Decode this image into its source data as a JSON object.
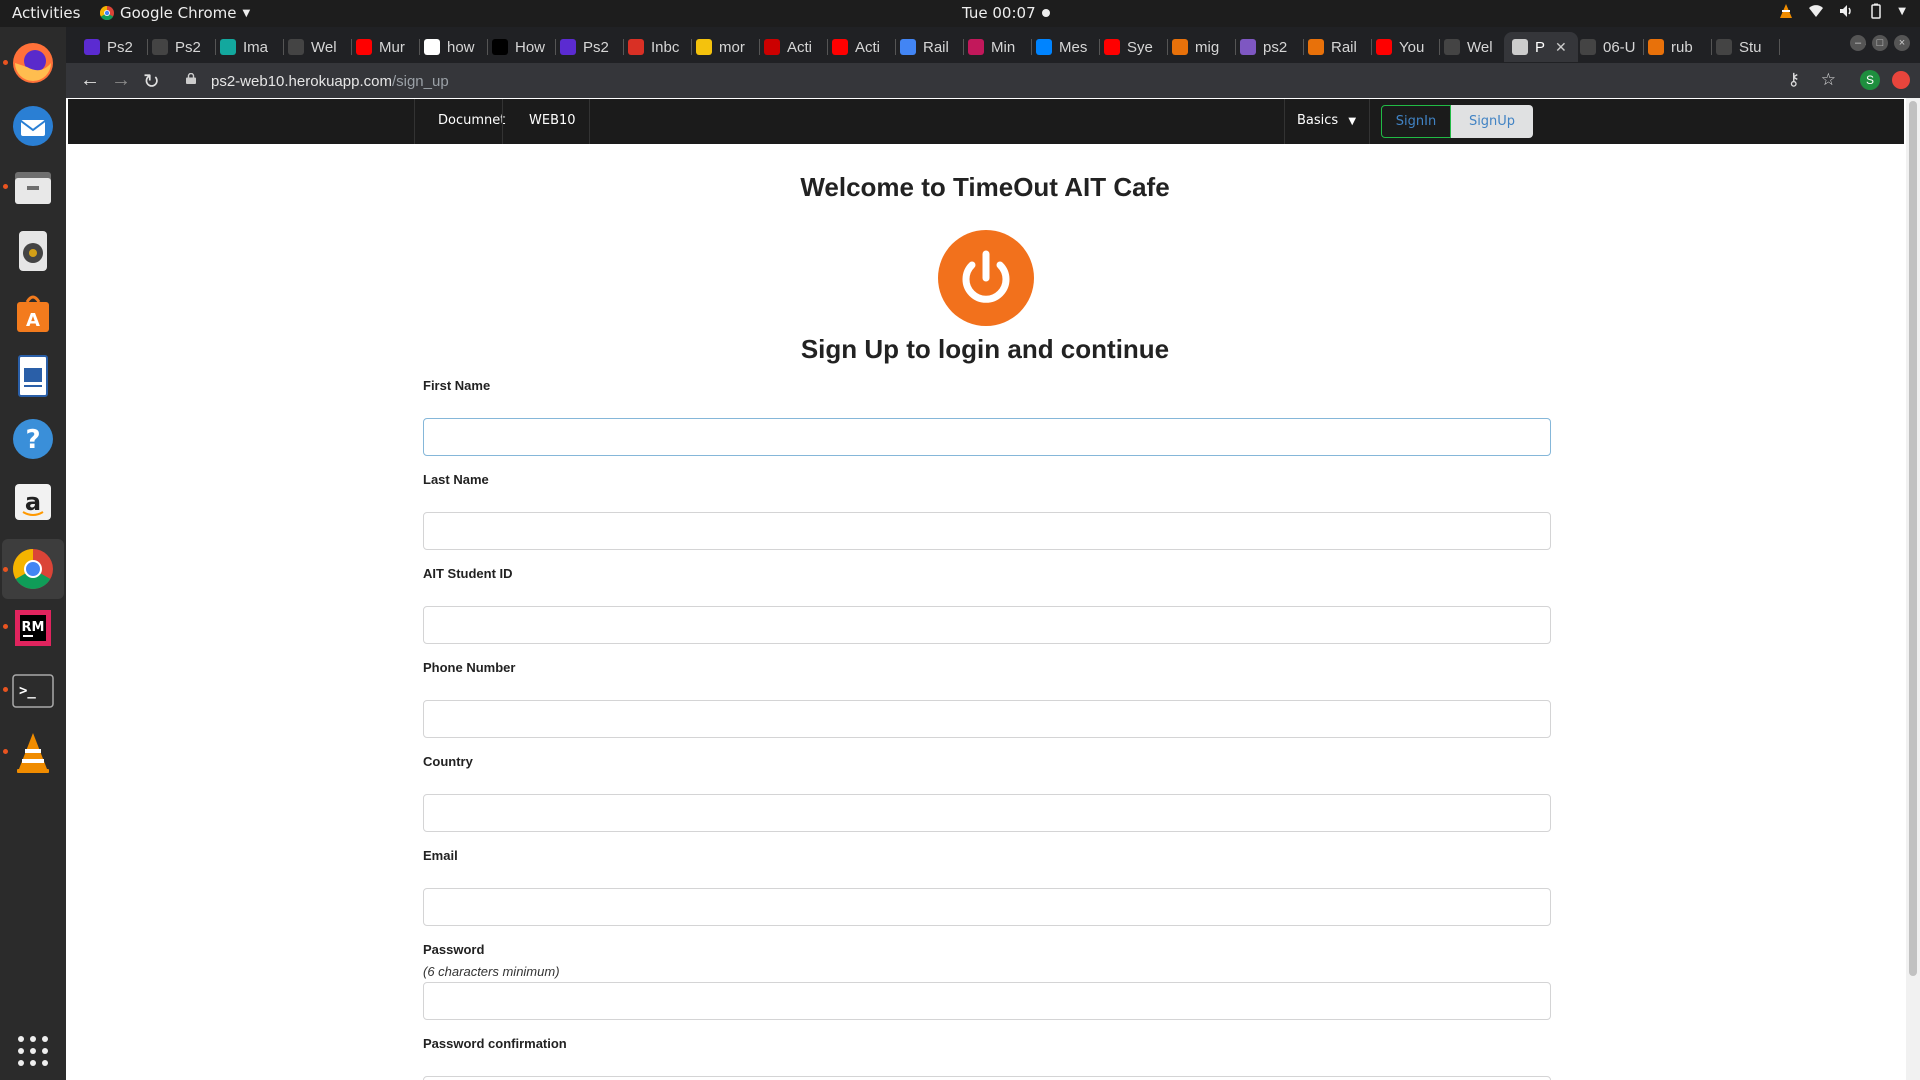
{
  "system_bar": {
    "activities": "Activities",
    "app_name": "Google Chrome",
    "clock": "Tue 00:07"
  },
  "dock": {
    "apps": [
      "firefox-icon",
      "thunderbird-icon",
      "files-icon",
      "rhythmbox-icon",
      "software-center-icon",
      "writer-icon",
      "help-icon",
      "amazon-icon",
      "chrome-icon",
      "rubymine-icon",
      "terminal-icon",
      "vlc-icon"
    ]
  },
  "browser": {
    "tabs": [
      {
        "label": "Ps2",
        "color": "#5b2bd1"
      },
      {
        "label": "Ps2",
        "color": "#444444"
      },
      {
        "label": "Ima",
        "color": "#13a89e"
      },
      {
        "label": "Wel",
        "color": "#444444"
      },
      {
        "label": "Mur",
        "color": "#ff0000"
      },
      {
        "label": "how",
        "color": "#ffffff"
      },
      {
        "label": "How",
        "color": "#000000"
      },
      {
        "label": "Ps2",
        "color": "#5b2bd1"
      },
      {
        "label": "Inbc",
        "color": "#d93025"
      },
      {
        "label": "mor",
        "color": "#f4c20d"
      },
      {
        "label": "Acti",
        "color": "#cc0000"
      },
      {
        "label": "Acti",
        "color": "#ff0000"
      },
      {
        "label": "Rail",
        "color": "#4285f4"
      },
      {
        "label": "Min",
        "color": "#c2185b"
      },
      {
        "label": "Mes",
        "color": "#0084ff"
      },
      {
        "label": "Sye",
        "color": "#ff0000"
      },
      {
        "label": "mig",
        "color": "#e8710a"
      },
      {
        "label": "ps2",
        "color": "#7e57c2"
      },
      {
        "label": "Rail",
        "color": "#e8710a"
      },
      {
        "label": "You",
        "color": "#ff0000"
      },
      {
        "label": "Wel",
        "color": "#444444"
      },
      {
        "label": "P",
        "color": "#cccccc",
        "active": true
      },
      {
        "label": "06-U",
        "color": "#444444"
      },
      {
        "label": "rub",
        "color": "#e8710a"
      },
      {
        "label": "Stu",
        "color": "#444444"
      }
    ],
    "url_host": "ps2-web10.herokuapp.com",
    "url_path": "/sign_up",
    "profile_initial": "S"
  },
  "site": {
    "nav": {
      "documnet": "Documnet",
      "web10": "WEB10",
      "basics": "Basics",
      "signin": "SignIn",
      "signup": "SignUp"
    },
    "welcome": "Welcome to TimeOut AIT Cafe",
    "subtitle": "Sign Up to login and continue",
    "accent_color": "#f2711c",
    "form": {
      "first_name": {
        "label": "First Name",
        "value": ""
      },
      "last_name": {
        "label": "Last Name",
        "value": ""
      },
      "student_id": {
        "label": "AIT Student ID",
        "value": ""
      },
      "phone": {
        "label": "Phone Number",
        "value": ""
      },
      "country": {
        "label": "Country",
        "value": ""
      },
      "email": {
        "label": "Email",
        "value": ""
      },
      "password": {
        "label": "Password",
        "hint": "(6 characters minimum)",
        "value": ""
      },
      "password_confirmation": {
        "label": "Password confirmation",
        "value": ""
      }
    }
  }
}
